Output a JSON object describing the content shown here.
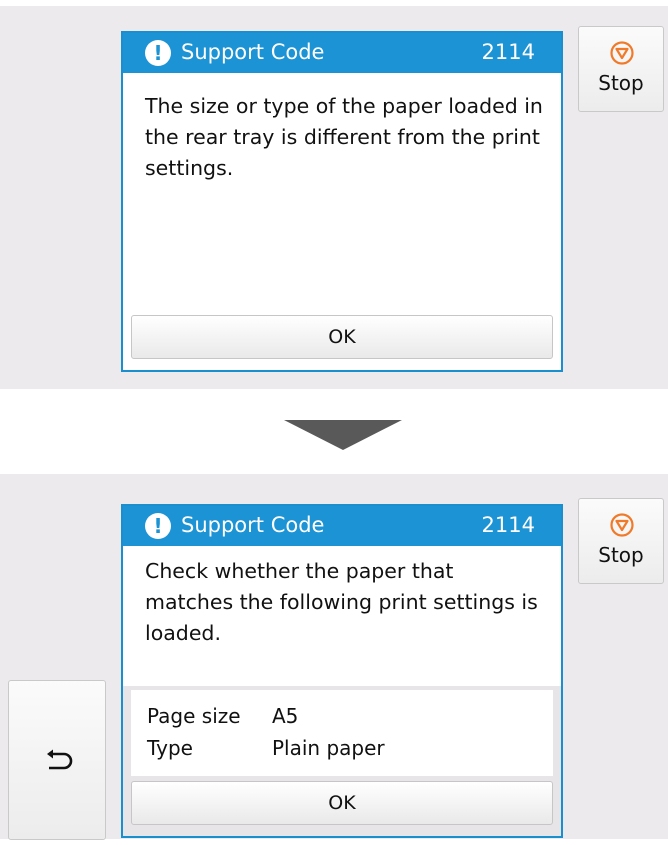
{
  "screen1": {
    "dialog": {
      "title": "Support Code",
      "code": "2114",
      "message": "The size or type of the paper loaded in the rear tray is different from the print settings.",
      "ok_label": "OK"
    },
    "stop_label": "Stop"
  },
  "screen2": {
    "dialog": {
      "title": "Support Code",
      "code": "2114",
      "message": "Check whether the paper that matches the following print settings is loaded.",
      "settings": [
        {
          "label": "Page size",
          "value": "A5"
        },
        {
          "label": "Type",
          "value": "Plain paper"
        }
      ],
      "ok_label": "OK"
    },
    "stop_label": "Stop",
    "back_icon": "back-arrow-icon"
  },
  "colors": {
    "header_blue": "#1c93d4",
    "stop_orange": "#f07a2a",
    "screen_bg": "#eceaec"
  }
}
